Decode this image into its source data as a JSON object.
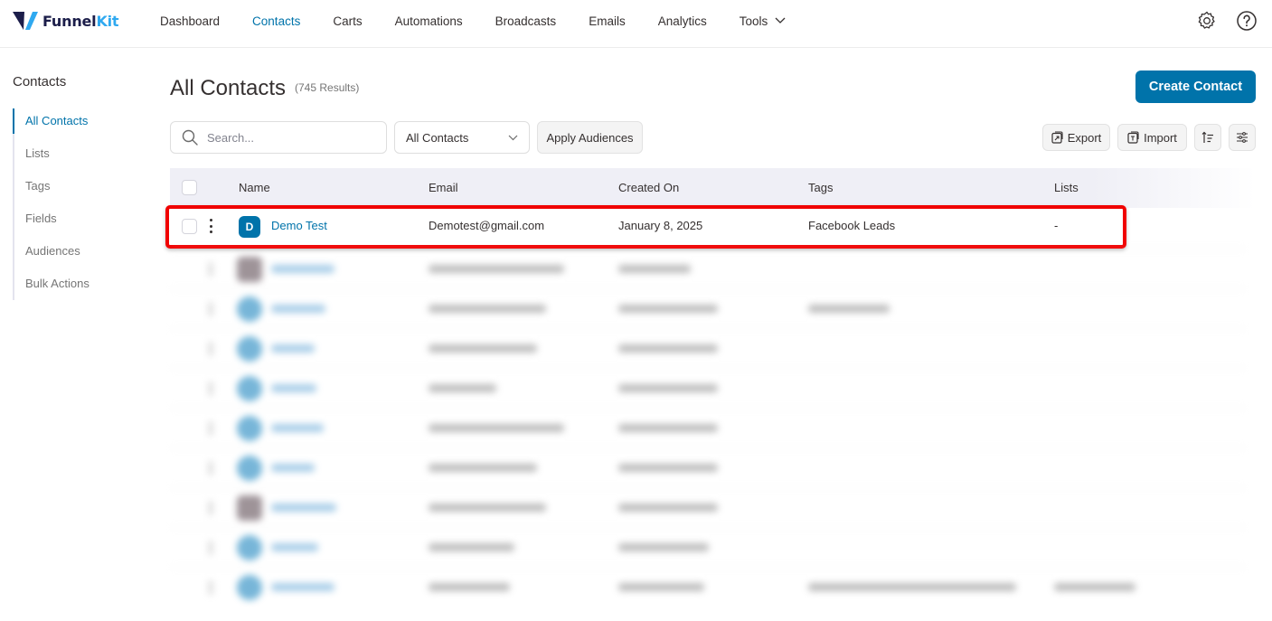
{
  "app": {
    "brand_main": "Funnel",
    "brand_accent": "Kit",
    "accent_color": "#0073aa",
    "highlight_color": "#f00000"
  },
  "nav": {
    "items": [
      {
        "label": "Dashboard",
        "active": false
      },
      {
        "label": "Contacts",
        "active": true
      },
      {
        "label": "Carts",
        "active": false
      },
      {
        "label": "Automations",
        "active": false
      },
      {
        "label": "Broadcasts",
        "active": false
      },
      {
        "label": "Emails",
        "active": false
      },
      {
        "label": "Analytics",
        "active": false
      },
      {
        "label": "Tools",
        "active": false,
        "has_dropdown": true
      }
    ],
    "icons": [
      "gear-icon",
      "help-icon"
    ]
  },
  "sidebar": {
    "title": "Contacts",
    "items": [
      {
        "label": "All Contacts",
        "active": true
      },
      {
        "label": "Lists",
        "active": false
      },
      {
        "label": "Tags",
        "active": false
      },
      {
        "label": "Fields",
        "active": false
      },
      {
        "label": "Audiences",
        "active": false
      },
      {
        "label": "Bulk Actions",
        "active": false
      }
    ]
  },
  "main": {
    "title": "All Contacts",
    "results": "(745 Results)",
    "create_label": "Create Contact",
    "search": {
      "placeholder": "Search...",
      "value": ""
    },
    "filter_select": {
      "value": "All Contacts"
    },
    "apply_label": "Apply Audiences",
    "export_label": "Export",
    "import_label": "Import"
  },
  "table": {
    "columns": [
      "Name",
      "Email",
      "Created On",
      "Tags",
      "Lists"
    ],
    "rows": [
      {
        "avatar_initial": "D",
        "name": "Demo Test",
        "email": "Demotest@gmail.com",
        "created_on": "January 8, 2025",
        "tags": "Facebook Leads",
        "lists": "-"
      }
    ],
    "blurred_row_count": 9
  }
}
